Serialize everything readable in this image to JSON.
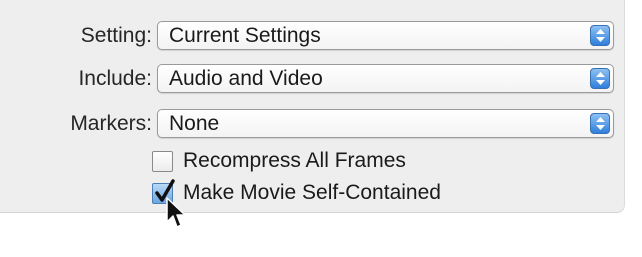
{
  "settings": {
    "setting": {
      "label": "Setting:",
      "value": "Current Settings"
    },
    "include": {
      "label": "Include:",
      "value": "Audio and Video"
    },
    "markers": {
      "label": "Markers:",
      "value": "None"
    }
  },
  "options": {
    "recompress": {
      "label": "Recompress All Frames",
      "checked": false
    },
    "self_contained": {
      "label": "Make Movie Self-Contained",
      "checked": true
    }
  },
  "icons": {
    "popup_arrows": "up-down-arrows-icon",
    "checkmark": "checkmark-icon",
    "cursor": "mouse-pointer-icon"
  },
  "colors": {
    "panel_background": "#eeeeee",
    "stepper_blue": "#2f7fdb"
  }
}
